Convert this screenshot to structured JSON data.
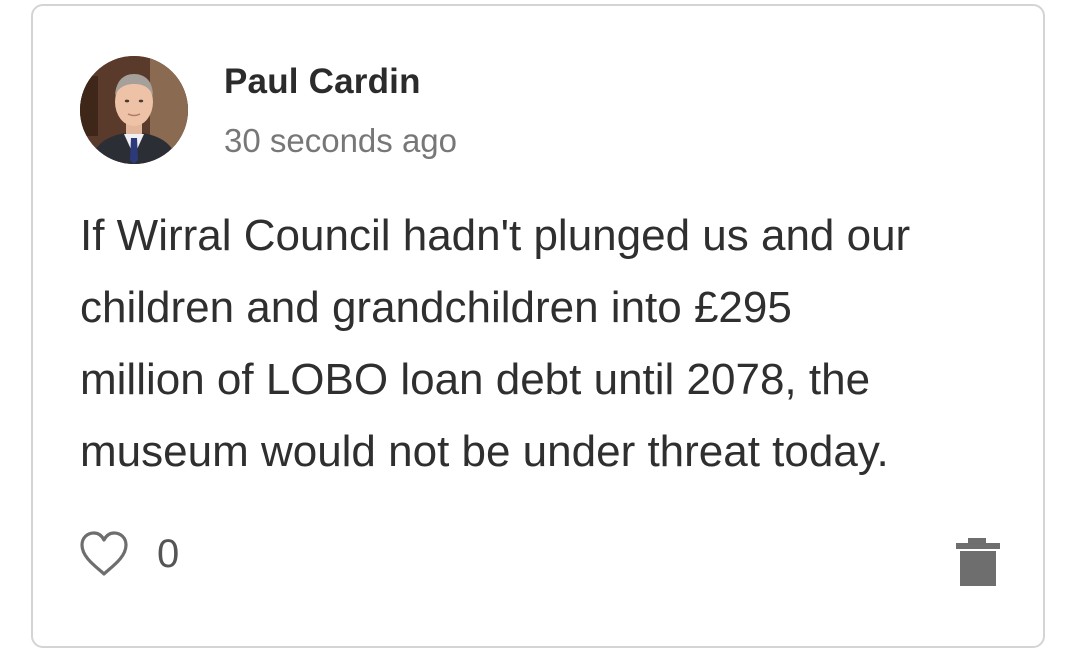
{
  "comment": {
    "author": "Paul Cardin",
    "timestamp": "30 seconds ago",
    "text": "If Wirral Council hadn't plunged us and our\nchildren and grandchildren into £295\nmillion of LOBO loan debt until 2078, the\nmuseum would not be under threat today.",
    "like_count": "0"
  },
  "icons": {
    "like": "heart-outline-icon",
    "delete": "trash-icon"
  },
  "colors": {
    "author_text": "#2b2b2b",
    "secondary_text": "#777777",
    "icon": "#6e6e6e",
    "border": "#d4d4d4"
  }
}
